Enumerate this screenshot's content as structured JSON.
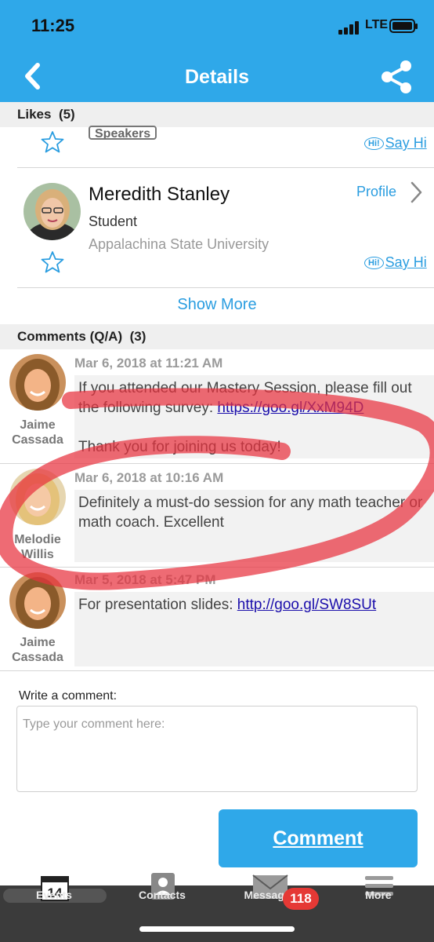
{
  "status_bar": {
    "time": "11:25",
    "network": "LTE"
  },
  "header": {
    "title": "Details",
    "back_icon": "chevron-left-icon",
    "share_icon": "share-icon"
  },
  "likes": {
    "heading": "Likes",
    "count": "(5)",
    "partial_item": {
      "badge": "Speakers",
      "say_hi": "Say Hi",
      "hi_bubble": "Hi!"
    },
    "person": {
      "name": "Meredith Stanley",
      "role": "Student",
      "organization": "Appalachina State University",
      "profile_label": "Profile",
      "say_hi": "Say Hi",
      "hi_bubble": "Hi!"
    },
    "show_more": "Show More"
  },
  "comments": {
    "heading": "Comments (Q/A)",
    "count": "(3)",
    "items": [
      {
        "author_first": "Jaime",
        "author_last": "Cassada",
        "date": "Mar 6, 2018 at 11:21 AM",
        "text_1": "If you attended our Mastery Session, please fill out the following survey: ",
        "link": "https://goo.gl/XxM94D",
        "text_2": "Thank you for joining us today!"
      },
      {
        "author_first": "Melodie",
        "author_last": "Willis",
        "date": "Mar 6, 2018 at 10:16 AM",
        "text_1": "Definitely a must-do session for any math teacher or math coach. Excellent"
      },
      {
        "author_first": "Jaime",
        "author_last": "Cassada",
        "date": "Mar 5, 2018 at 5:47 PM",
        "text_1": "For presentation slides: ",
        "link": "http://goo.gl/SW8SUt"
      }
    ]
  },
  "write_comment": {
    "label": "Write a comment:",
    "placeholder": "Type your comment here:",
    "button": "Comment"
  },
  "tabbar": {
    "tabs": [
      {
        "label": "Events",
        "icon": "calendar-icon",
        "icon_text": "14"
      },
      {
        "label": "Contacts",
        "icon": "contacts-icon"
      },
      {
        "label": "Messages",
        "icon": "envelope-icon"
      },
      {
        "label": "More",
        "icon": "menu-icon"
      }
    ],
    "messages_badge": "118"
  },
  "colors": {
    "accent": "#2fa8e9",
    "link": "#2a9de0",
    "badge": "#e53935",
    "tabbar": "#3b3b3b",
    "marker": "#e8323f"
  }
}
